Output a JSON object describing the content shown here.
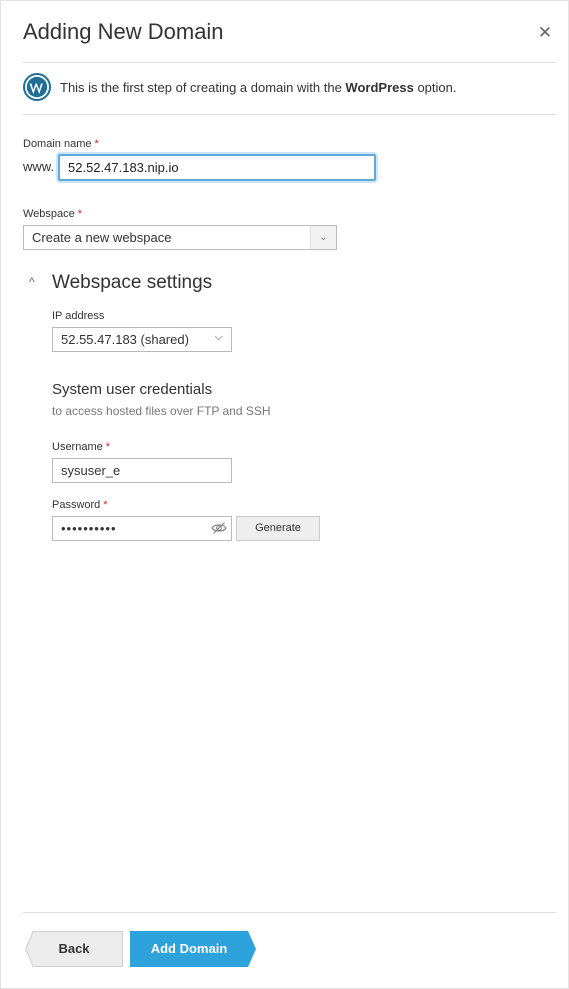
{
  "dialog": {
    "title": "Adding New Domain",
    "close_icon": "close-icon"
  },
  "info": {
    "icon": "wordpress-icon",
    "text_before": "This is the first step of creating a domain with the ",
    "text_bold": "WordPress",
    "text_after": " option."
  },
  "domain": {
    "label": "Domain name",
    "required_mark": "*",
    "prefix": "www.",
    "value": "52.52.47.183.nip.io"
  },
  "webspace": {
    "label": "Webspace",
    "required_mark": "*",
    "selected": "Create a new webspace",
    "arrow_icon": "chevron-down-icon"
  },
  "webspace_settings": {
    "toggle_icon": "chevron-up-icon",
    "title": "Webspace settings",
    "ip": {
      "label": "IP address",
      "selected": "52.55.47.183 (shared)",
      "arrow_icon": "chevron-down-icon"
    },
    "credentials": {
      "title": "System user credentials",
      "description": "to access hosted files over FTP and SSH",
      "username": {
        "label": "Username",
        "required_mark": "*",
        "value": "sysuser_e"
      },
      "password": {
        "label": "Password",
        "required_mark": "*",
        "value": "••••••••••",
        "eye_icon": "eye-slash-icon"
      },
      "generate_label": "Generate"
    }
  },
  "footer": {
    "back_label": "Back",
    "add_label": "Add Domain"
  },
  "colors": {
    "primary": "#2ea2db",
    "required": "#d02b2b",
    "wordpress": "#1f6f96",
    "focus": "#5fa8d8"
  }
}
